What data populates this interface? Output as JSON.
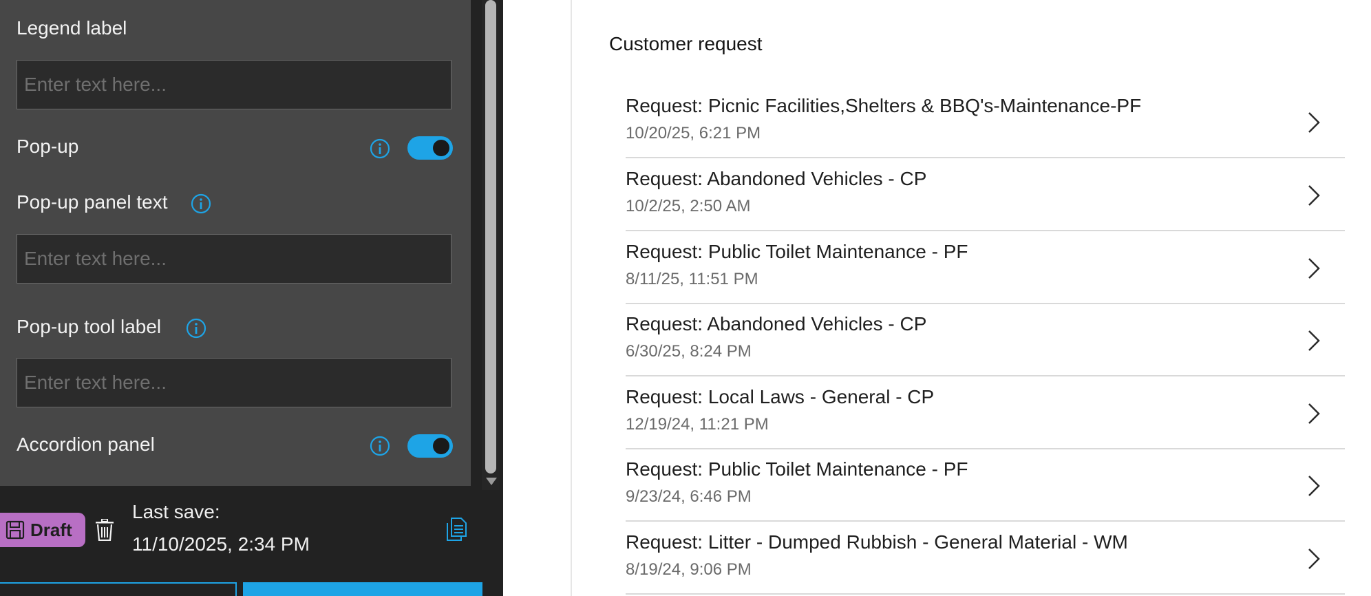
{
  "settings": {
    "legend_label": "Legend label",
    "legend_placeholder": "Enter text here...",
    "popup_label": "Pop-up",
    "popup_toggle_on": true,
    "popup_panel_text_label": "Pop-up panel text",
    "popup_panel_text_placeholder": "Enter text here...",
    "popup_tool_label": "Pop-up tool label",
    "popup_tool_placeholder": "Enter text here...",
    "accordion_label": "Accordion panel",
    "accordion_toggle_on": true
  },
  "footer": {
    "draft_label": "Draft",
    "last_save_label": "Last save:",
    "last_save_value": "11/10/2025, 2:34 PM"
  },
  "colors": {
    "accent": "#1ea4e6",
    "draft_badge": "#b86fc4"
  },
  "icons": [
    "info-icon",
    "save-icon",
    "trash-icon",
    "document-icon",
    "chevron-right-icon"
  ],
  "customer_request": {
    "title": "Customer request",
    "items": [
      {
        "title": "Request: Picnic Facilities,Shelters & BBQ's-Maintenance-PF",
        "date": "10/20/25, 6:21 PM"
      },
      {
        "title": "Request: Abandoned Vehicles - CP",
        "date": "10/2/25, 2:50 AM"
      },
      {
        "title": "Request: Public Toilet Maintenance - PF",
        "date": "8/11/25, 11:51 PM"
      },
      {
        "title": "Request: Abandoned Vehicles - CP",
        "date": "6/30/25, 8:24 PM"
      },
      {
        "title": "Request: Local Laws - General - CP",
        "date": "12/19/24, 11:21 PM"
      },
      {
        "title": "Request: Public Toilet Maintenance - PF",
        "date": "9/23/24, 6:46 PM"
      },
      {
        "title": "Request: Litter - Dumped Rubbish - General Material - WM",
        "date": "8/19/24, 9:06 PM"
      }
    ]
  }
}
